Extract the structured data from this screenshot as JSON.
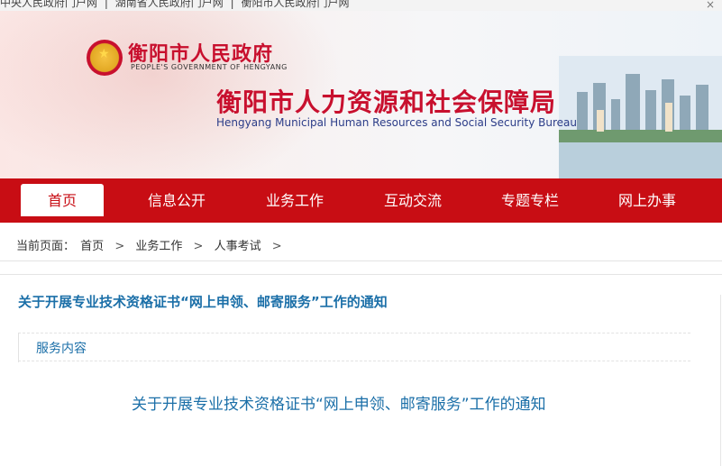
{
  "top_links": [
    "中央人民政府门户网",
    "|",
    "湖南省人民政府门户网",
    "|",
    "衡阳市人民政府门户网"
  ],
  "header": {
    "gov_cn": "衡阳市人民政府",
    "gov_en": "PEOPLE'S GOVERNMENT OF HENGYANG",
    "bureau_cn": "衡阳市人力资源和社会保障局",
    "bureau_en": "Hengyang Municipal Human Resources and Social Security Bureau"
  },
  "nav": [
    "首页",
    "信息公开",
    "业务工作",
    "互动交流",
    "专题专栏",
    "网上办事"
  ],
  "breadcrumb": {
    "prefix": "当前页面：",
    "items": [
      "首页",
      "业务工作",
      "人事考试"
    ],
    "sep": ">"
  },
  "content": {
    "title": "关于开展专业技术资格证书“网上申领、邮寄服务”工作的通知",
    "section_label": "服务内容",
    "article_title": "关于开展专业技术资格证书“网上申领、邮寄服务”工作的通知"
  }
}
